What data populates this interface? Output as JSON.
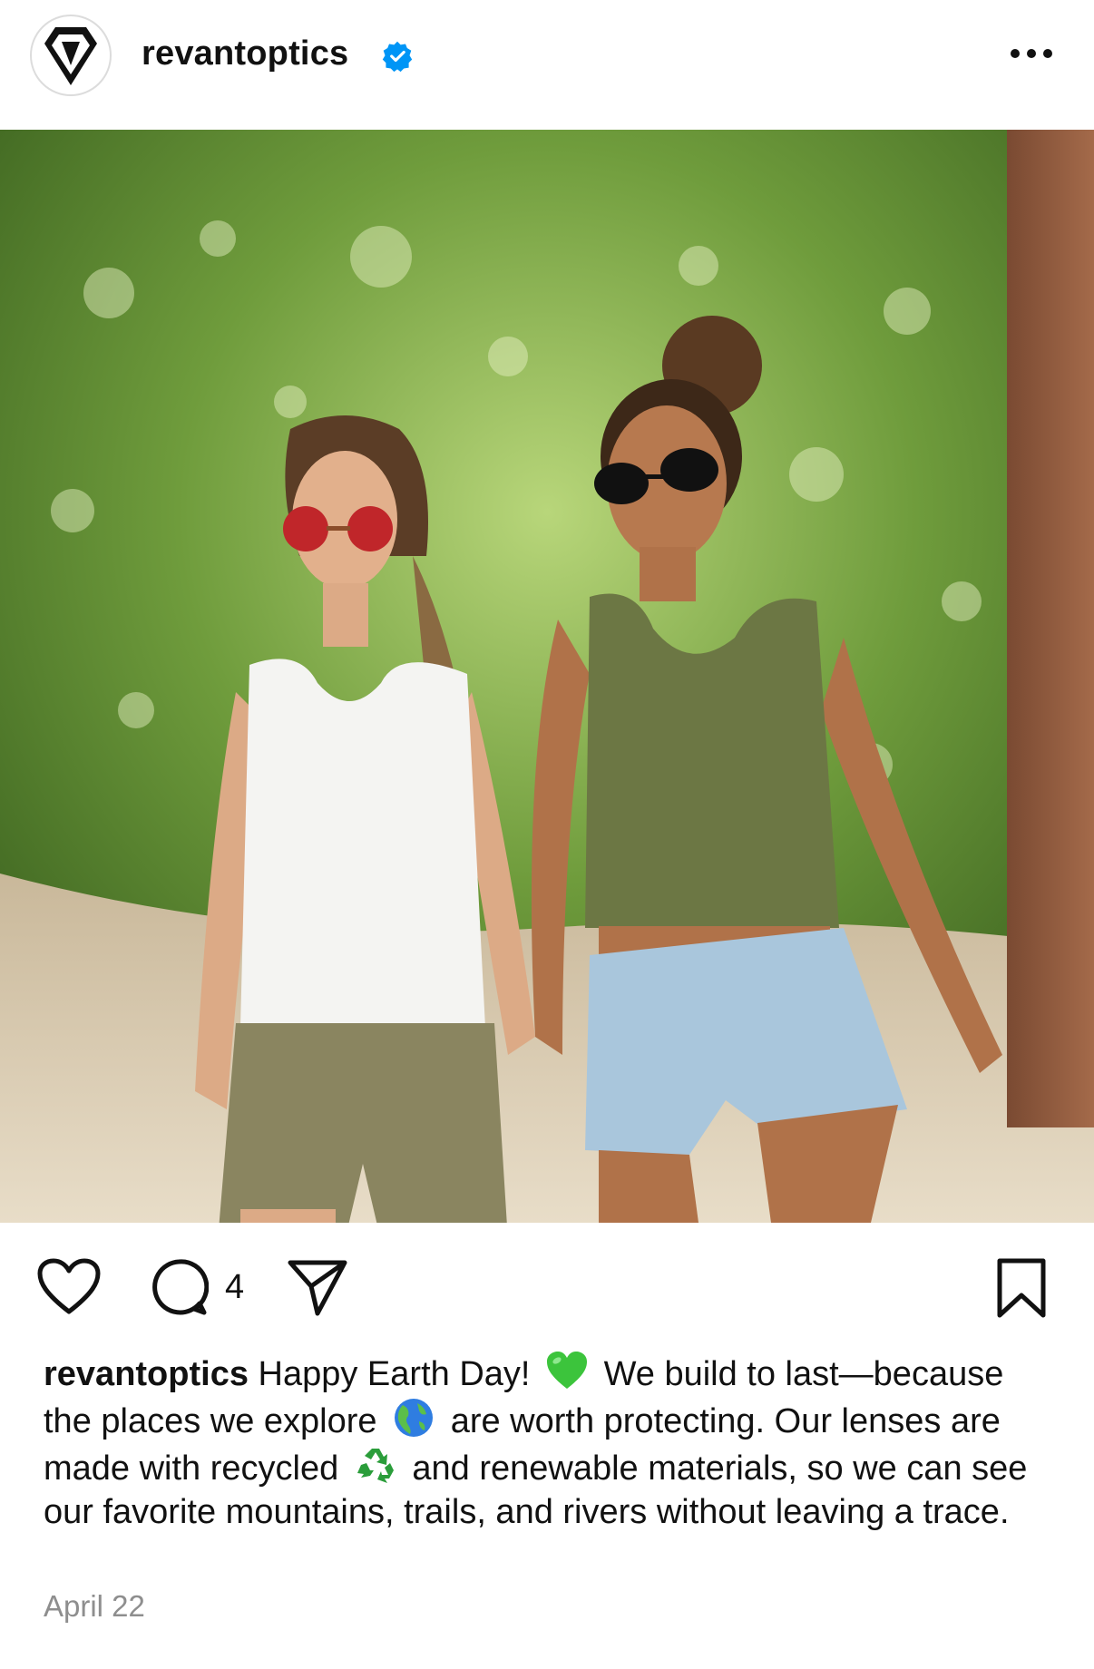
{
  "post": {
    "username": "revantoptics",
    "verified": true,
    "more_icon": "more-horizontal-icon",
    "photo_alt": "Two women in sunglasses walking on a forest trail",
    "actions": {
      "like_icon": "heart-icon",
      "comment_icon": "comment-icon",
      "comment_count": "4",
      "share_icon": "paper-plane-icon",
      "save_icon": "bookmark-icon"
    },
    "caption": {
      "user": "revantoptics",
      "part1": "Happy Earth Day!",
      "emoji1": "💚",
      "part2": "We build to last—because the places we explore",
      "emoji2": "🌍",
      "part3": "are worth protecting. Our lenses are made with recycled",
      "emoji3": "♻️",
      "part4": "and renewable materials, so we can see our favorite mountains, trails, and rivers without leaving a trace."
    },
    "date": "April 22"
  },
  "colors": {
    "verified_blue": "#0095f6",
    "date_gray": "#8e8e8e",
    "text": "#111111"
  }
}
